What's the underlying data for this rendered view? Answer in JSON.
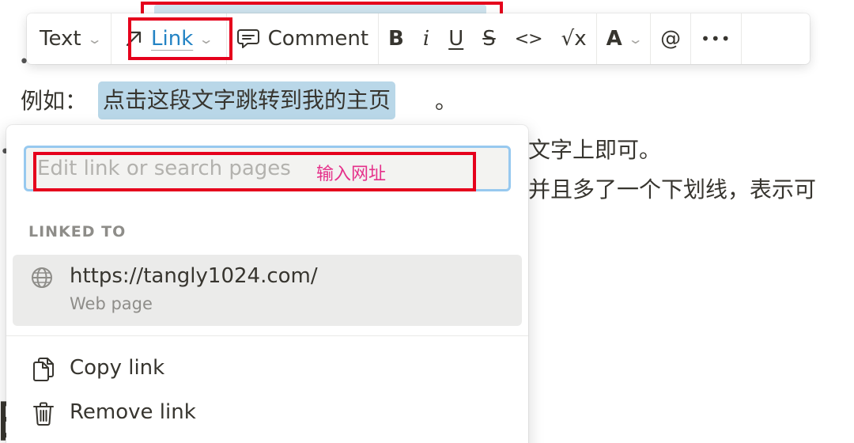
{
  "toolbar": {
    "text_label": "Text",
    "link_label": "Link",
    "comment_label": "Comment",
    "bold_label": "B",
    "italic_label": "i",
    "underline_label": "U",
    "strike_label": "S",
    "code_label": "<>",
    "equation_label": "√x",
    "color_label": "A",
    "mention_label": "@",
    "more_label": "•••"
  },
  "document": {
    "example_prefix": "例如：",
    "example_link_text": "点击这段文字跳转到我的主页",
    "example_suffix": "。",
    "right_line_1": "文字上即可。",
    "right_line_2": "并且多了一个下划线，表示可"
  },
  "link_popup": {
    "input_placeholder": "Edit link or search pages",
    "input_value": "",
    "annotation": "输入网址",
    "section_label": "LINKED TO",
    "linked_url": "https://tangly1024.com/",
    "linked_type": "Web page",
    "copy_label": "Copy link",
    "remove_label": "Remove link"
  },
  "colors": {
    "accent_link": "#2383c4",
    "annotation_red": "#e5001c",
    "annotation_pink": "#e5308a",
    "highlight": "#b9d7e8"
  }
}
